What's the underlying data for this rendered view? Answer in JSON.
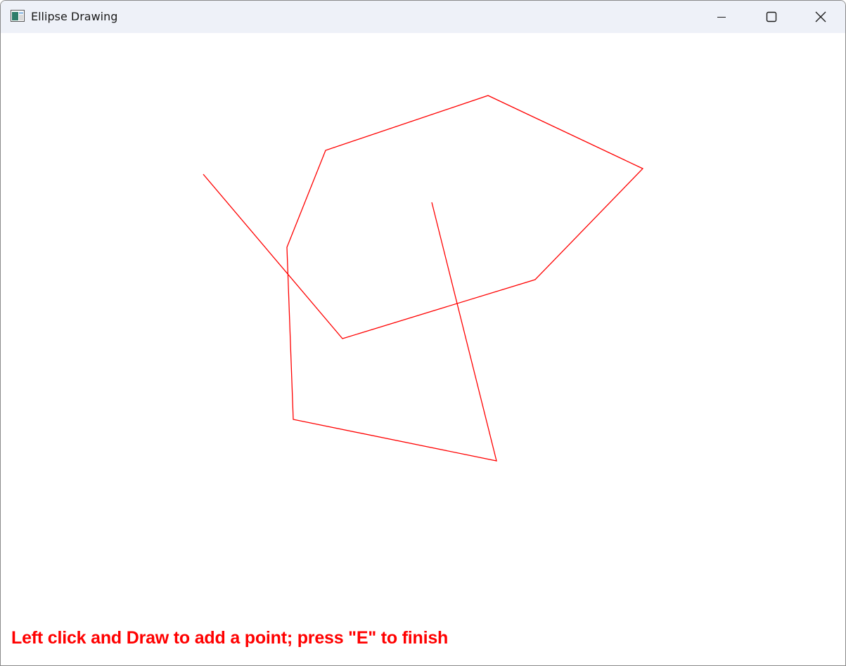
{
  "window": {
    "title": "Ellipse Drawing",
    "app_icon": "window-app-icon",
    "controls": {
      "minimize_icon": "minimize-icon",
      "maximize_icon": "maximize-icon",
      "close_icon": "close-icon"
    }
  },
  "canvas": {
    "stroke_color": "#ff0000",
    "instruction": "Left click and Draw to add a point; press \"E\" to finish"
  }
}
